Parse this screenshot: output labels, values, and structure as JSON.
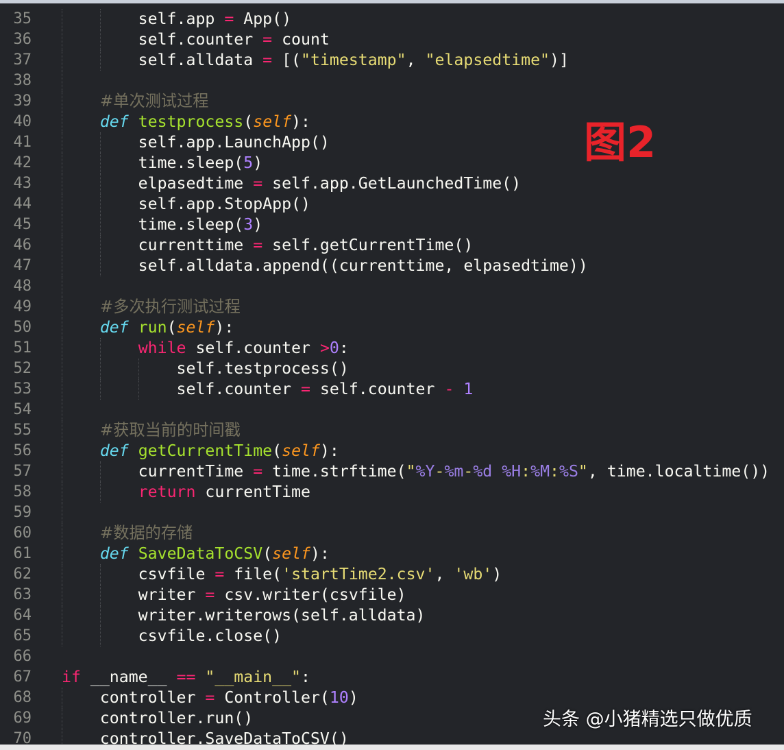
{
  "figure_label": "图2",
  "watermark": "头条 @小猪精选只做优质",
  "colors": {
    "background": "#232529",
    "keyword": "#f92672",
    "def": "#66d9ef",
    "function": "#a6e22e",
    "param": "#fd971f",
    "string": "#e6db74",
    "number": "#ae81ff",
    "comment": "#75715e",
    "label": "#e8232a"
  },
  "lines": [
    {
      "n": "35",
      "t": [
        [
          "",
          "        self.app "
        ],
        [
          "op",
          "="
        ],
        [
          "",
          " App()"
        ]
      ]
    },
    {
      "n": "36",
      "t": [
        [
          "",
          "        self.counter "
        ],
        [
          "op",
          "="
        ],
        [
          "",
          " count"
        ]
      ]
    },
    {
      "n": "37",
      "t": [
        [
          "",
          "        self.alldata "
        ],
        [
          "op",
          "="
        ],
        [
          "",
          " [("
        ],
        [
          "str",
          "\"timestamp\""
        ],
        [
          "",
          ", "
        ],
        [
          "str",
          "\"elapsedtime\""
        ],
        [
          "",
          ")]"
        ]
      ]
    },
    {
      "n": "38",
      "t": []
    },
    {
      "n": "39",
      "t": [
        [
          "",
          "    "
        ],
        [
          "cm",
          "#单次测试过程"
        ]
      ]
    },
    {
      "n": "40",
      "t": [
        [
          "",
          "    "
        ],
        [
          "def",
          "def"
        ],
        [
          "",
          " "
        ],
        [
          "fn",
          "testprocess"
        ],
        [
          "",
          "("
        ],
        [
          "param",
          "self"
        ],
        [
          "",
          "):"
        ]
      ]
    },
    {
      "n": "41",
      "t": [
        [
          "",
          "        self.app.LaunchApp()"
        ]
      ]
    },
    {
      "n": "42",
      "t": [
        [
          "",
          "        time.sleep("
        ],
        [
          "num",
          "5"
        ],
        [
          "",
          ")"
        ]
      ]
    },
    {
      "n": "43",
      "t": [
        [
          "",
          "        elpasedtime "
        ],
        [
          "op",
          "="
        ],
        [
          "",
          " self.app.GetLaunchedTime()"
        ]
      ]
    },
    {
      "n": "44",
      "t": [
        [
          "",
          "        self.app.StopApp()"
        ]
      ]
    },
    {
      "n": "45",
      "t": [
        [
          "",
          "        time.sleep("
        ],
        [
          "num",
          "3"
        ],
        [
          "",
          ")"
        ]
      ]
    },
    {
      "n": "46",
      "t": [
        [
          "",
          "        currenttime "
        ],
        [
          "op",
          "="
        ],
        [
          "",
          " self.getCurrentTime()"
        ]
      ]
    },
    {
      "n": "47",
      "t": [
        [
          "",
          "        self.alldata.append((currenttime, elpasedtime))"
        ]
      ]
    },
    {
      "n": "48",
      "t": []
    },
    {
      "n": "49",
      "t": [
        [
          "",
          "    "
        ],
        [
          "cm",
          "#多次执行测试过程"
        ]
      ]
    },
    {
      "n": "50",
      "t": [
        [
          "",
          "    "
        ],
        [
          "def",
          "def"
        ],
        [
          "",
          " "
        ],
        [
          "fn",
          "run"
        ],
        [
          "",
          "("
        ],
        [
          "param",
          "self"
        ],
        [
          "",
          "):"
        ]
      ]
    },
    {
      "n": "51",
      "t": [
        [
          "",
          "        "
        ],
        [
          "kw",
          "while"
        ],
        [
          "",
          " self.counter "
        ],
        [
          "op",
          ">"
        ],
        [
          "num",
          "0"
        ],
        [
          "",
          ":"
        ]
      ]
    },
    {
      "n": "52",
      "t": [
        [
          "",
          "            self.testprocess()"
        ]
      ]
    },
    {
      "n": "53",
      "t": [
        [
          "",
          "            self.counter "
        ],
        [
          "op",
          "="
        ],
        [
          "",
          " self.counter "
        ],
        [
          "op",
          "-"
        ],
        [
          "",
          " "
        ],
        [
          "num",
          "1"
        ]
      ]
    },
    {
      "n": "54",
      "t": []
    },
    {
      "n": "55",
      "t": [
        [
          "",
          "    "
        ],
        [
          "cm",
          "#获取当前的时间戳"
        ]
      ]
    },
    {
      "n": "56",
      "t": [
        [
          "",
          "    "
        ],
        [
          "def",
          "def"
        ],
        [
          "",
          " "
        ],
        [
          "fn",
          "getCurrentTime"
        ],
        [
          "",
          "("
        ],
        [
          "param",
          "self"
        ],
        [
          "",
          "):"
        ]
      ]
    },
    {
      "n": "57",
      "t": [
        [
          "",
          "        currentTime "
        ],
        [
          "op",
          "="
        ],
        [
          "",
          " time.strftime("
        ],
        [
          "str",
          "\""
        ],
        [
          "fmt",
          "%Y"
        ],
        [
          "str",
          "-"
        ],
        [
          "fmt",
          "%m"
        ],
        [
          "str",
          "-"
        ],
        [
          "fmt",
          "%d"
        ],
        [
          "str",
          " "
        ],
        [
          "fmt",
          "%H"
        ],
        [
          "str",
          ":"
        ],
        [
          "fmt",
          "%M"
        ],
        [
          "str",
          ":"
        ],
        [
          "fmt",
          "%S"
        ],
        [
          "str",
          "\""
        ],
        [
          "",
          ", time.localtime())"
        ]
      ]
    },
    {
      "n": "58",
      "t": [
        [
          "",
          "        "
        ],
        [
          "kw",
          "return"
        ],
        [
          "",
          " currentTime"
        ]
      ]
    },
    {
      "n": "59",
      "t": []
    },
    {
      "n": "60",
      "t": [
        [
          "",
          "    "
        ],
        [
          "cm",
          "#数据的存储"
        ]
      ]
    },
    {
      "n": "61",
      "t": [
        [
          "",
          "    "
        ],
        [
          "def",
          "def"
        ],
        [
          "",
          " "
        ],
        [
          "fn",
          "SaveDataToCSV"
        ],
        [
          "",
          "("
        ],
        [
          "param",
          "self"
        ],
        [
          "",
          "):"
        ]
      ]
    },
    {
      "n": "62",
      "t": [
        [
          "",
          "        csvfile "
        ],
        [
          "op",
          "="
        ],
        [
          "",
          " file("
        ],
        [
          "str",
          "'startTime2.csv'"
        ],
        [
          "",
          ", "
        ],
        [
          "str",
          "'wb'"
        ],
        [
          "",
          ")"
        ]
      ]
    },
    {
      "n": "63",
      "t": [
        [
          "",
          "        writer "
        ],
        [
          "op",
          "="
        ],
        [
          "",
          " csv.writer(csvfile)"
        ]
      ]
    },
    {
      "n": "64",
      "t": [
        [
          "",
          "        writer.writerows(self.alldata)"
        ]
      ]
    },
    {
      "n": "65",
      "t": [
        [
          "",
          "        csvfile.close()"
        ]
      ]
    },
    {
      "n": "66",
      "t": []
    },
    {
      "n": "67",
      "t": [
        [
          "kw",
          "if"
        ],
        [
          "",
          " __name__ "
        ],
        [
          "op",
          "=="
        ],
        [
          "",
          " "
        ],
        [
          "str",
          "\"__main__\""
        ],
        [
          "",
          ":"
        ]
      ]
    },
    {
      "n": "68",
      "t": [
        [
          "",
          "    controller "
        ],
        [
          "op",
          "="
        ],
        [
          "",
          " Controller("
        ],
        [
          "num",
          "10"
        ],
        [
          "",
          ")"
        ]
      ]
    },
    {
      "n": "69",
      "t": [
        [
          "",
          "    controller.run()"
        ]
      ]
    },
    {
      "n": "70",
      "t": [
        [
          "",
          "    controller.SaveDataToCSV()"
        ]
      ]
    }
  ]
}
